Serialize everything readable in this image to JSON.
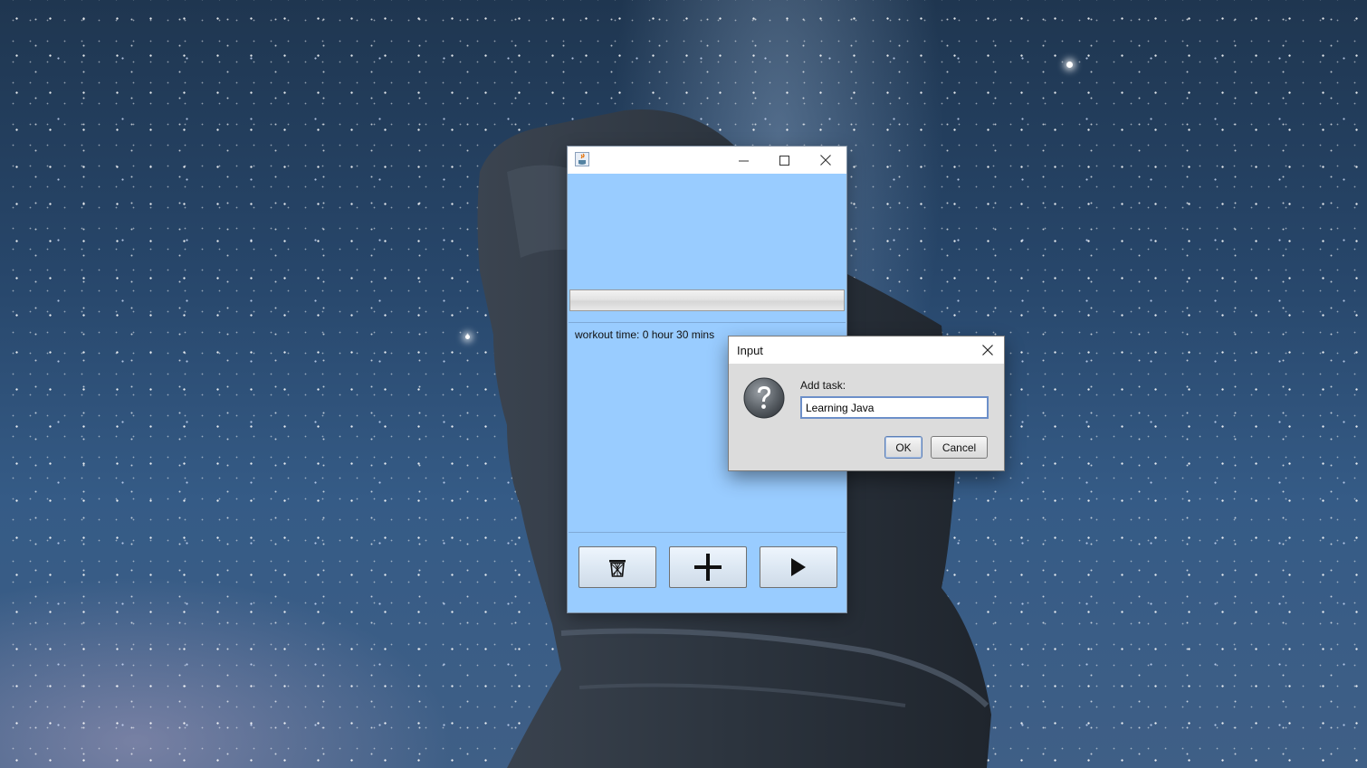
{
  "desktop": {
    "wallpaper": "starry night sky with moai statue",
    "colors": {
      "sky": "#27466a",
      "statue": "#2d3642"
    }
  },
  "main_window": {
    "title": "",
    "icons": {
      "app": "java-cup-icon",
      "minimize": "minimize-icon",
      "maximize": "maximize-icon",
      "close": "close-icon"
    },
    "background": "#99ccff",
    "workout_label": "workout time: 0 hour 30 mins",
    "buttons": [
      {
        "name": "delete",
        "icon": "trash-icon"
      },
      {
        "name": "add",
        "icon": "plus-icon"
      },
      {
        "name": "play",
        "icon": "play-icon"
      }
    ]
  },
  "dialog": {
    "title": "Input",
    "icon": "question-icon",
    "prompt": "Add task:",
    "input_value": "Learning Java",
    "ok_label": "OK",
    "cancel_label": "Cancel"
  }
}
